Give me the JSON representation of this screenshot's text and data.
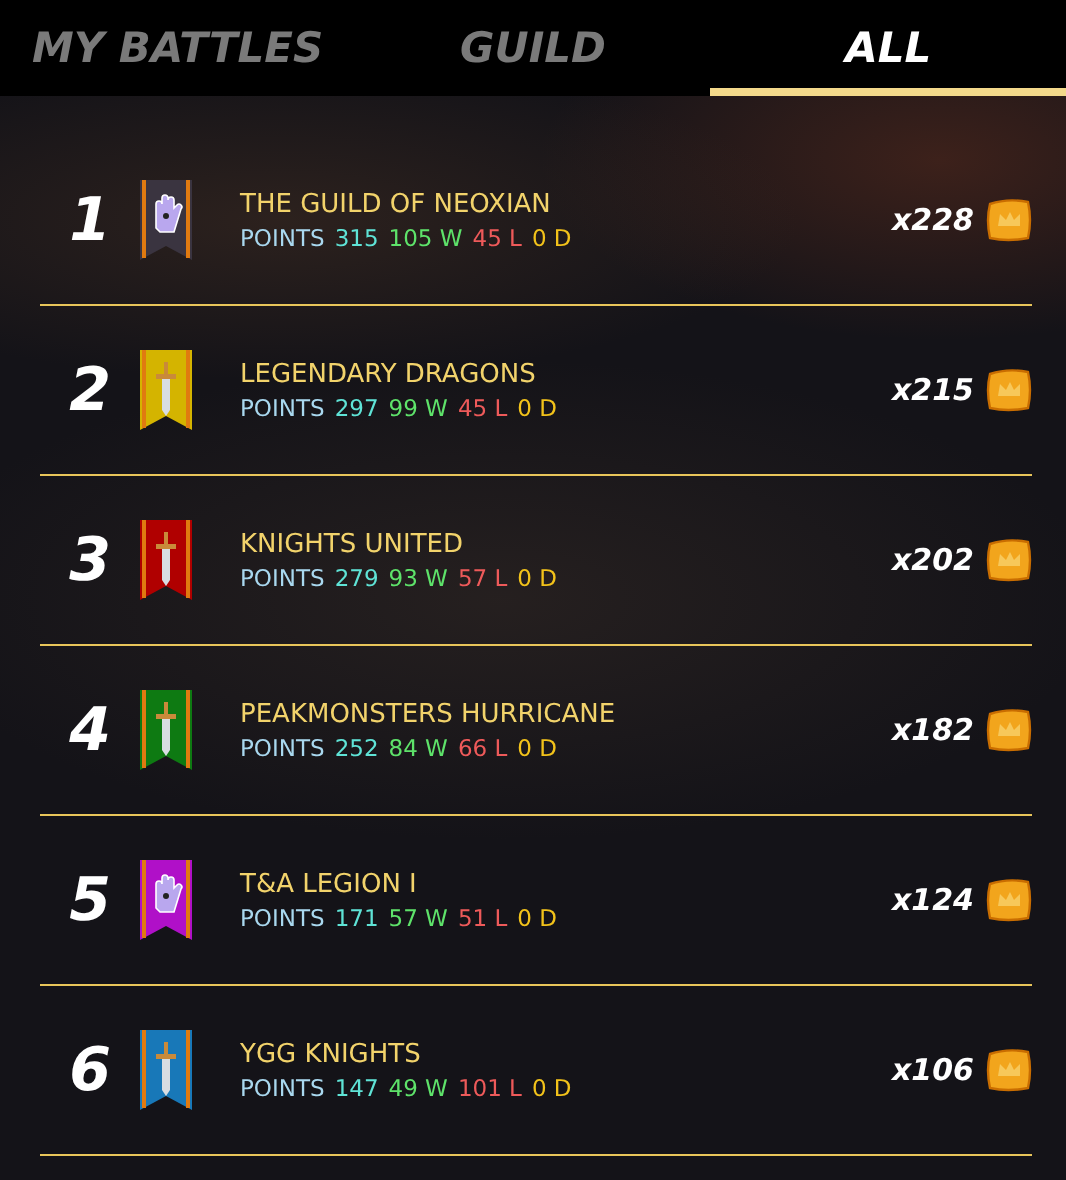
{
  "tabs": [
    {
      "label": "MY BATTLES",
      "selected": false
    },
    {
      "label": "GUILD",
      "selected": false
    },
    {
      "label": "ALL",
      "selected": true
    }
  ],
  "guilds": [
    {
      "rank": "1",
      "name": "THE GUILD OF NEOXIAN",
      "points_label": "POINTS",
      "points": "315",
      "wins": "105 W",
      "losses": "45 L",
      "draws": "0 D",
      "reward": "x228",
      "color": "#3a3440",
      "kind": "hand"
    },
    {
      "rank": "2",
      "name": "LEGENDARY DRAGONS",
      "points_label": "POINTS",
      "points": "297",
      "wins": "99 W",
      "losses": "45 L",
      "draws": "0 D",
      "reward": "x215",
      "color": "#d4b400",
      "kind": "sword"
    },
    {
      "rank": "3",
      "name": "KNIGHTS UNITED",
      "points_label": "POINTS",
      "points": "279",
      "wins": "93 W",
      "losses": "57 L",
      "draws": "0 D",
      "reward": "x202",
      "color": "#b00000",
      "kind": "sword"
    },
    {
      "rank": "4",
      "name": "PEAKMONSTERS HURRICANE",
      "points_label": "POINTS",
      "points": "252",
      "wins": "84 W",
      "losses": "66 L",
      "draws": "0 D",
      "reward": "x182",
      "color": "#0e7a12",
      "kind": "sword"
    },
    {
      "rank": "5",
      "name": "T&A LEGION I",
      "points_label": "POINTS",
      "points": "171",
      "wins": "57 W",
      "losses": "51 L",
      "draws": "0 D",
      "reward": "x124",
      "color": "#b010c8",
      "kind": "hand"
    },
    {
      "rank": "6",
      "name": "YGG KNIGHTS",
      "points_label": "POINTS",
      "points": "147",
      "wins": "49 W",
      "losses": "101 L",
      "draws": "0 D",
      "reward": "x106",
      "color": "#1878b8",
      "kind": "sword"
    }
  ]
}
